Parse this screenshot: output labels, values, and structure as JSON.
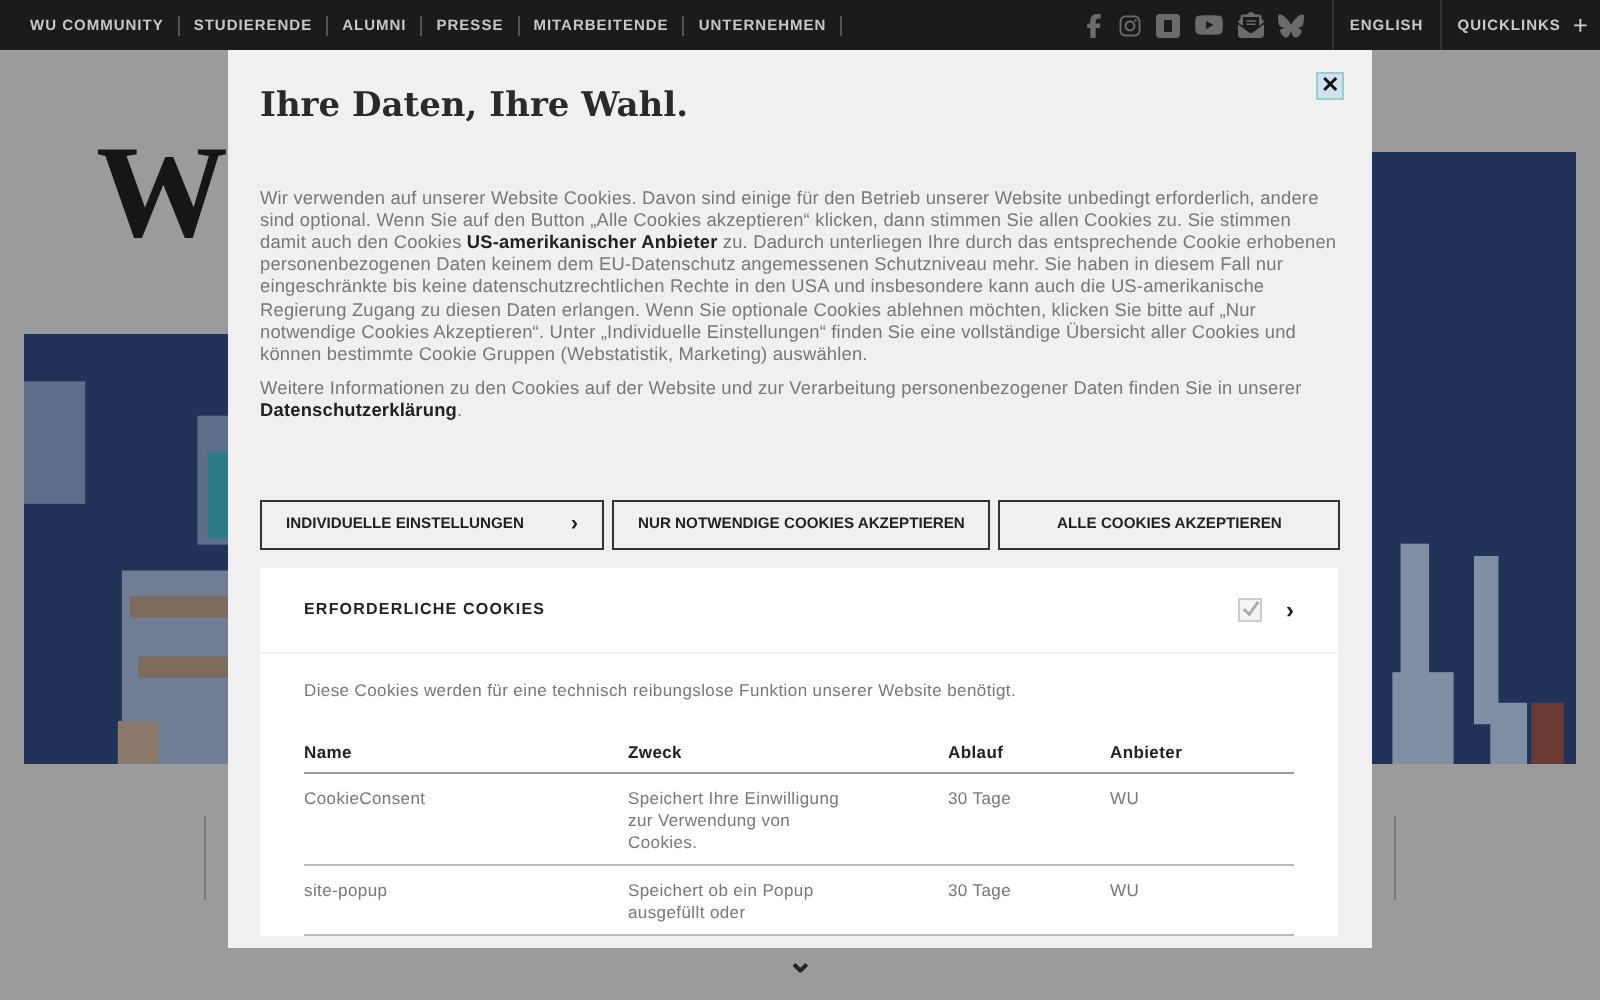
{
  "top_nav": {
    "links": [
      "WU COMMUNITY",
      "STUDIERENDE",
      "ALUMNI",
      "PRESSE",
      "MITARBEITENDE",
      "UNTERNEHMEN"
    ],
    "language": "ENGLISH",
    "quicklinks": "QUICKLINKS",
    "quicklinks_icon": "+"
  },
  "background": {
    "logo_fragment": "W"
  },
  "dialog": {
    "title": "Ihre Daten, Ihre Wahl.",
    "close": "✕",
    "paragraphs": [
      "Wir verwenden auf unserer Website Cookies. Davon sind einige für den Betrieb unserer Website unbedingt erforderlich, andere sind optional. Wenn Sie auf den Button „Alle Cookies akzeptieren“ klicken, dann stimmen Sie allen Cookies zu. Sie stimmen damit auch den Cookies **US-amerikanischer Anbieter** zu. Dadurch unterliegen Ihre durch das entsprechende Cookie erhobenen personenbezogenen Daten keinem dem EU-Datenschutz angemessenen Schutzniveau mehr. Sie haben in diesem Fall nur eingeschränkte bis keine datenschutzrechtlichen Rechte in den USA und insbesondere kann auch die US-amerikanische Regierung Zugang zu diesen Daten erlangen. Wenn Sie optionale Cookies ablehnen möchten, klicken Sie bitte auf „Nur notwendige Cookies Akzeptieren“. Unter „Individuelle Einstellungen“ finden Sie eine vollständige Übersicht aller Cookies und können bestimmte Cookie Gruppen (Webstatistik, Marketing) auswählen.",
      "Weitere Informationen zu den Cookies auf der Website und zur Verarbeitung personenbezogener Daten finden Sie in unserer **Datenschutzerklärung**."
    ],
    "buttons": [
      {
        "label": "INDIVIDUELLE EINSTELLUNGEN",
        "chevron": "›"
      },
      {
        "label": "NUR NOTWENDIGE COOKIES AKZEPTIEREN"
      },
      {
        "label": "ALLE COOKIES AKZEPTIEREN"
      }
    ],
    "section": {
      "title": "ERFORDERLICHE COOKIES",
      "checked": true,
      "disabled": true,
      "chevron": "›",
      "description": "Diese Cookies werden für eine technisch reibungslose Funktion unserer Website benötigt.",
      "table": {
        "columns": [
          "Name",
          "Zweck",
          "Ablauf",
          "Anbieter"
        ],
        "rows": [
          [
            "CookieConsent",
            "Speichert Ihre Einwilligung zur Verwendung von Cookies.",
            "30 Tage",
            "WU"
          ],
          [
            "site-popup",
            "Speichert ob ein Popup ausgefüllt oder",
            "30 Tage",
            "WU"
          ]
        ]
      }
    }
  },
  "scroll_hint": "⌄"
}
